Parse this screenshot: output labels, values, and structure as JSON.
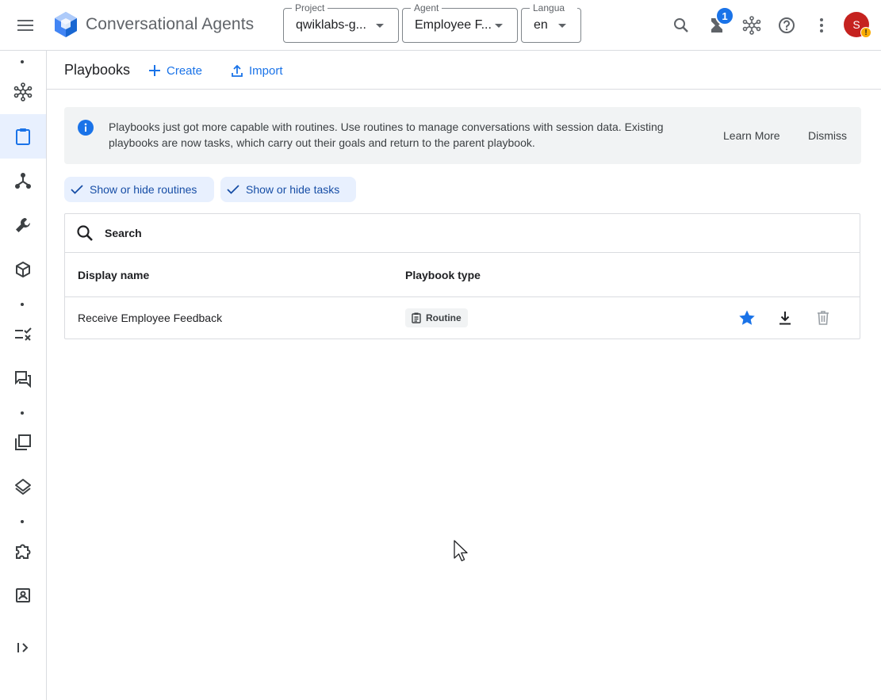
{
  "app": {
    "title": "Conversational Agents"
  },
  "selectors": {
    "project": {
      "label": "Project",
      "value": "qwiklabs-g..."
    },
    "agent": {
      "label": "Agent",
      "value": "Employee F..."
    },
    "language": {
      "label": "Langua",
      "value": "en"
    }
  },
  "topbar": {
    "notification_count": "1",
    "avatar_initial": "S",
    "avatar_warning": "!"
  },
  "page": {
    "title": "Playbooks",
    "create_label": "Create",
    "import_label": "Import"
  },
  "banner": {
    "text": "Playbooks just got more capable with routines. Use routines to manage conversations with session data. Existing playbooks are now tasks, which carry out their goals and return to the parent playbook.",
    "learn_more": "Learn More",
    "dismiss": "Dismiss"
  },
  "filters": {
    "routines": "Show or hide routines",
    "tasks": "Show or hide tasks"
  },
  "table": {
    "search_placeholder": "Search",
    "columns": {
      "name": "Display name",
      "type": "Playbook type"
    },
    "rows": [
      {
        "name": "Receive Employee Feedback",
        "type": "Routine"
      }
    ]
  },
  "colors": {
    "accent": "#1a73e8",
    "avatar": "#c5221f",
    "warning": "#f9ab00"
  }
}
